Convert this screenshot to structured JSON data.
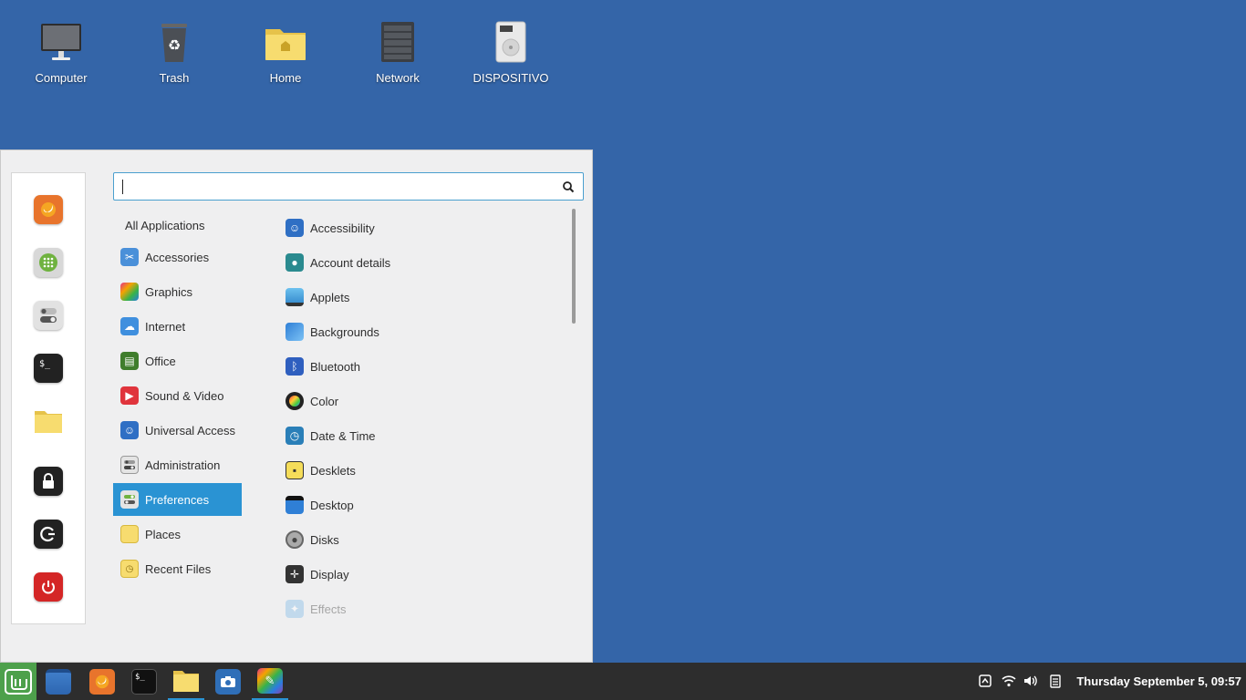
{
  "desktop": {
    "icons": [
      {
        "label": "Computer",
        "icon": "computer-icon"
      },
      {
        "label": "Trash",
        "icon": "trash-icon"
      },
      {
        "label": "Home",
        "icon": "home-folder-icon"
      },
      {
        "label": "Network",
        "icon": "network-icon"
      },
      {
        "label": "DISPOSITIVO",
        "icon": "drive-icon"
      }
    ]
  },
  "menu": {
    "search": {
      "value": "",
      "placeholder": ""
    },
    "favorites": [
      {
        "name": "firefox",
        "icon": "firefox-icon"
      },
      {
        "name": "software-manager",
        "icon": "software-manager-icon"
      },
      {
        "name": "settings",
        "icon": "toggle-settings-icon"
      },
      {
        "name": "terminal",
        "icon": "terminal-icon"
      },
      {
        "name": "files",
        "icon": "folder-icon"
      },
      {
        "name": "lock",
        "icon": "lock-icon"
      },
      {
        "name": "logout",
        "icon": "logout-icon"
      },
      {
        "name": "shutdown",
        "icon": "power-icon"
      }
    ],
    "categories": [
      {
        "label": "All Applications"
      },
      {
        "label": "Accessories"
      },
      {
        "label": "Graphics"
      },
      {
        "label": "Internet"
      },
      {
        "label": "Office"
      },
      {
        "label": "Sound & Video"
      },
      {
        "label": "Universal Access"
      },
      {
        "label": "Administration"
      },
      {
        "label": "Preferences",
        "selected": true
      },
      {
        "label": "Places"
      },
      {
        "label": "Recent Files"
      }
    ],
    "apps": [
      {
        "label": "Accessibility"
      },
      {
        "label": "Account details"
      },
      {
        "label": "Applets"
      },
      {
        "label": "Backgrounds"
      },
      {
        "label": "Bluetooth"
      },
      {
        "label": "Color"
      },
      {
        "label": "Date & Time"
      },
      {
        "label": "Desklets"
      },
      {
        "label": "Desktop"
      },
      {
        "label": "Disks"
      },
      {
        "label": "Display"
      },
      {
        "label": "Effects"
      }
    ]
  },
  "panel": {
    "launchers": [
      "mint-menu-icon",
      "show-desktop-icon",
      "firefox-icon",
      "terminal-icon",
      "files-icon",
      "screenshot-icon",
      "drawing-icon"
    ],
    "clock": "Thursday September  5, 09:57"
  },
  "colors": {
    "accent": "#2a93d3",
    "desktop": "#3465a8",
    "panel": "#2d2d2d"
  }
}
